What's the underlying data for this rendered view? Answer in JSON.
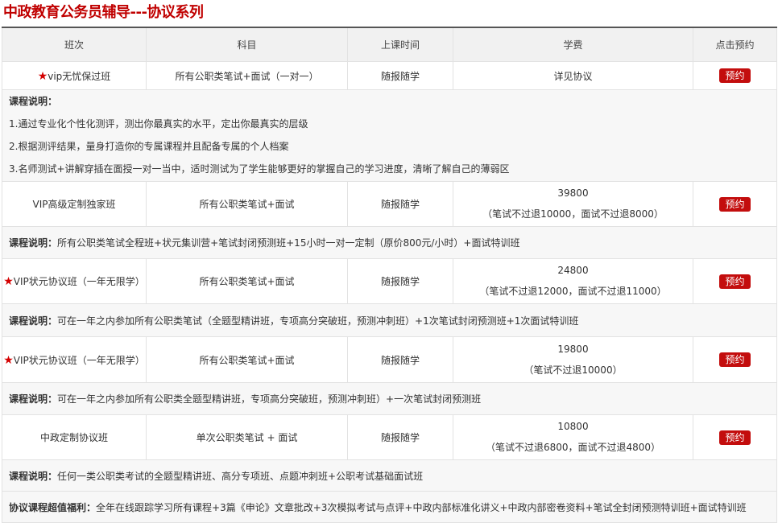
{
  "page_title": "中政教育公务员辅导---协议系列",
  "table": {
    "headers": [
      "班次",
      "科目",
      "上课时间",
      "学费",
      "点击预约"
    ],
    "book_label": "预约",
    "rows": [
      {
        "class_name": "vip无忧保过班",
        "starred": true,
        "subject": "所有公职类笔试+面试（一对一）",
        "time": "随报随学",
        "fee": "详见协议",
        "fee_note": "",
        "desc_label": "课程说明：",
        "desc_lines": [
          "1.通过专业化个性化测评，测出你最真实的水平，定出你最真实的层级",
          "2.根据测评结果，量身打造你的专属课程并且配备专属的个人档案",
          "3.名师测试+讲解穿插在面授一对一当中，适时测试为了学生能够更好的掌握自己的学习进度，清晰了解自己的薄弱区"
        ]
      },
      {
        "class_name": "VIP高级定制独家班",
        "starred": false,
        "subject": "所有公职类笔试+面试",
        "time": "随报随学",
        "fee": "39800",
        "fee_note": "（笔试不过退10000，面试不过退8000）",
        "desc_label": "课程说明：",
        "desc_text": "所有公职类笔试全程班+状元集训营+笔试封闭预测班+15小时一对一定制（原价800元/小时）+面试特训班"
      },
      {
        "class_name": "VIP状元协议班（一年无限学）",
        "starred": true,
        "subject": "所有公职类笔试+面试",
        "time": "随报随学",
        "fee": "24800",
        "fee_note": "（笔试不过退12000，面试不过退11000）",
        "desc_label": "课程说明：",
        "desc_text": "可在一年之内参加所有公职类笔试（全题型精讲班，专项高分突破班，预测冲刺班）+1次笔试封闭预测班+1次面试特训班"
      },
      {
        "class_name": "VIP状元协议班（一年无限学）",
        "starred": true,
        "subject": "所有公职类笔试+面试",
        "time": "随报随学",
        "fee": "19800",
        "fee_note": "（笔试不过退10000）",
        "desc_label": "课程说明：",
        "desc_text": "可在一年之内参加所有公职类全题型精讲班，专项高分突破班，预测冲刺班）+一次笔试封闭预测班"
      },
      {
        "class_name": "中政定制协议班",
        "starred": false,
        "subject": "单次公职类笔试 + 面试",
        "time": "随报随学",
        "fee": "10800",
        "fee_note": "（笔试不过退6800，面试不过退4800）",
        "desc_label": "课程说明：",
        "desc_text": "任何一类公职类考试的全题型精讲班、高分专项班、点题冲刺班+公职考试基础面试班"
      }
    ],
    "bonus_label": "协议课程超值福利：",
    "bonus_text": "全年在线跟踪学习所有课程+3篇《申论》文章批改+3次模拟考试与点评+中政内部标准化讲义+中政内部密卷资料+笔试全封闭预测特训班+面试特训班"
  },
  "colors": {
    "title": "#c00000",
    "button": "#c30d0d",
    "star": "#d40000",
    "header_bg": "#f1f1f1",
    "desc_bg": "#f7f7f7"
  },
  "icons": {
    "star": "star-icon"
  }
}
